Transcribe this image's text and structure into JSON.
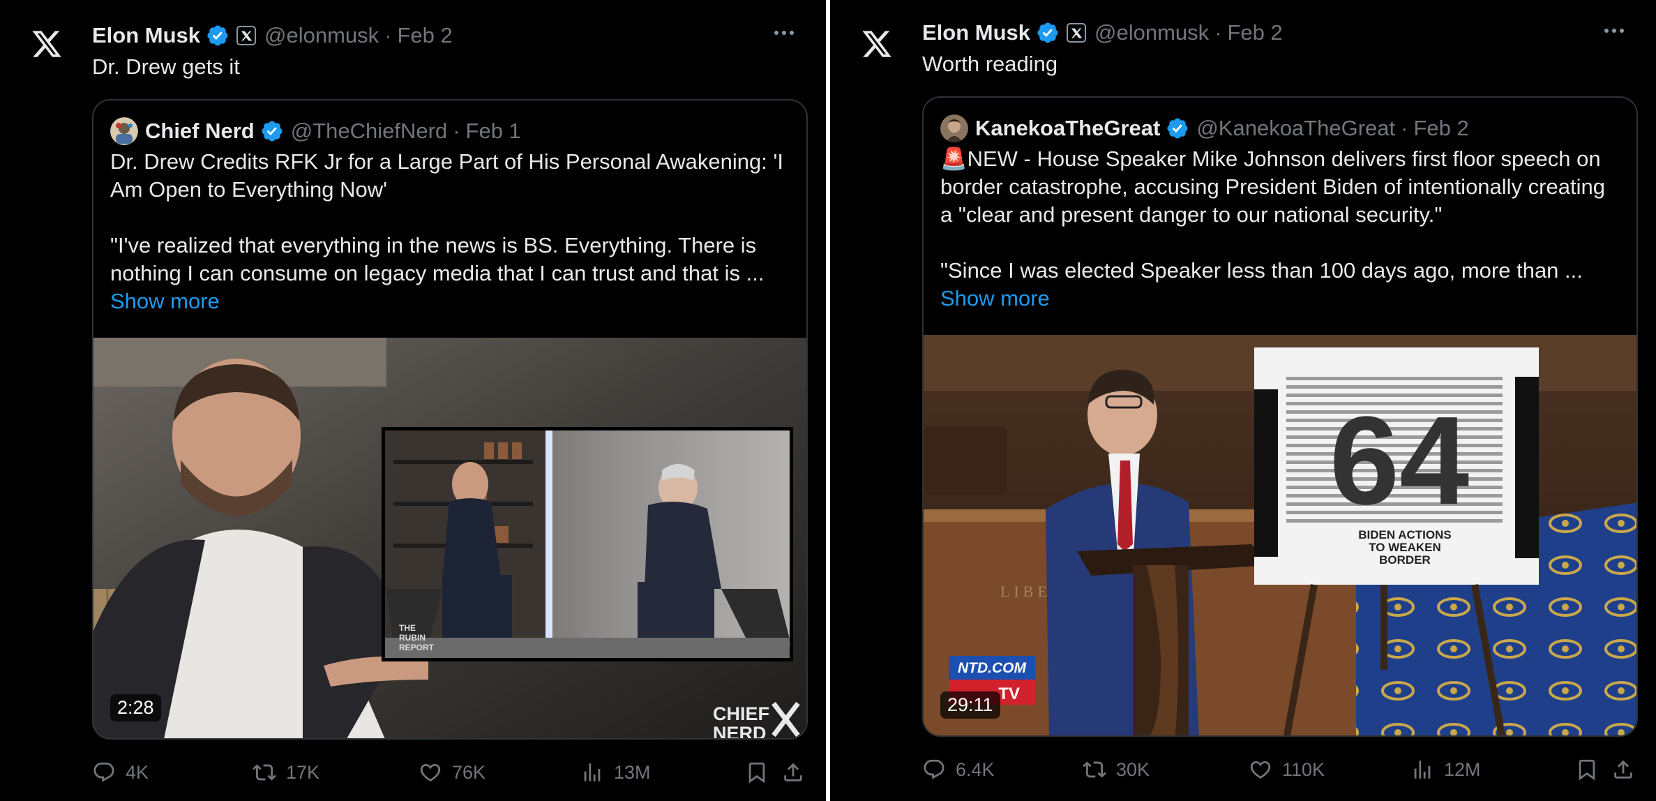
{
  "tweets": [
    {
      "author": {
        "name": "Elon Musk",
        "handle": "@elonmusk",
        "date": "Feb 2"
      },
      "text": "Dr. Drew gets it",
      "quote": {
        "author": {
          "name": "Chief Nerd",
          "handle": "@TheChiefNerd",
          "date": "Feb 1"
        },
        "line1": "Dr. Drew Credits RFK Jr for a Large Part of His Personal Awakening: 'I Am Open to Everything Now'",
        "line2": "\"I've realized that everything in the news is BS. Everything. There is nothing I can consume on legacy media that I can trust and that is ...",
        "show_more": "Show more",
        "video": {
          "duration": "2:28",
          "overlay_text": [
            "THE RUBIN REPORT",
            "CHIEF NERD"
          ],
          "description": "Two men in an interview studio, large close-up of host with inset shot of both seated"
        }
      },
      "actions": {
        "replies": "4K",
        "retweets": "17K",
        "likes": "76K",
        "views": "13M"
      }
    },
    {
      "author": {
        "name": "Elon Musk",
        "handle": "@elonmusk",
        "date": "Feb 2"
      },
      "text": "Worth reading",
      "quote": {
        "author": {
          "name": "KanekoaTheGreat",
          "handle": "@KanekoaTheGreat",
          "date": "Feb 2"
        },
        "line1": "🚨NEW - House Speaker Mike Johnson delivers first floor speech on border catastrophe, accusing President Biden of intentionally creating a \"clear and present danger to our national security.\"",
        "line2": "\"Since I was elected Speaker less than 100 days ago, more than ...",
        "show_more": "Show more",
        "video": {
          "duration": "29:11",
          "poster_number": "64",
          "poster_caption": "BIDEN ACTIONS TO WEAKEN BORDER",
          "logo_text": "NTD.COM",
          "logo_sub": "TV"
        }
      },
      "actions": {
        "replies": "6.4K",
        "retweets": "30K",
        "likes": "110K",
        "views": "12M"
      }
    }
  ],
  "colors": {
    "background": "#000000",
    "text": "#e7e9ea",
    "muted": "#71767b",
    "link": "#1d9bf0",
    "border": "#2f3336",
    "verified": "#1d9bf0"
  }
}
